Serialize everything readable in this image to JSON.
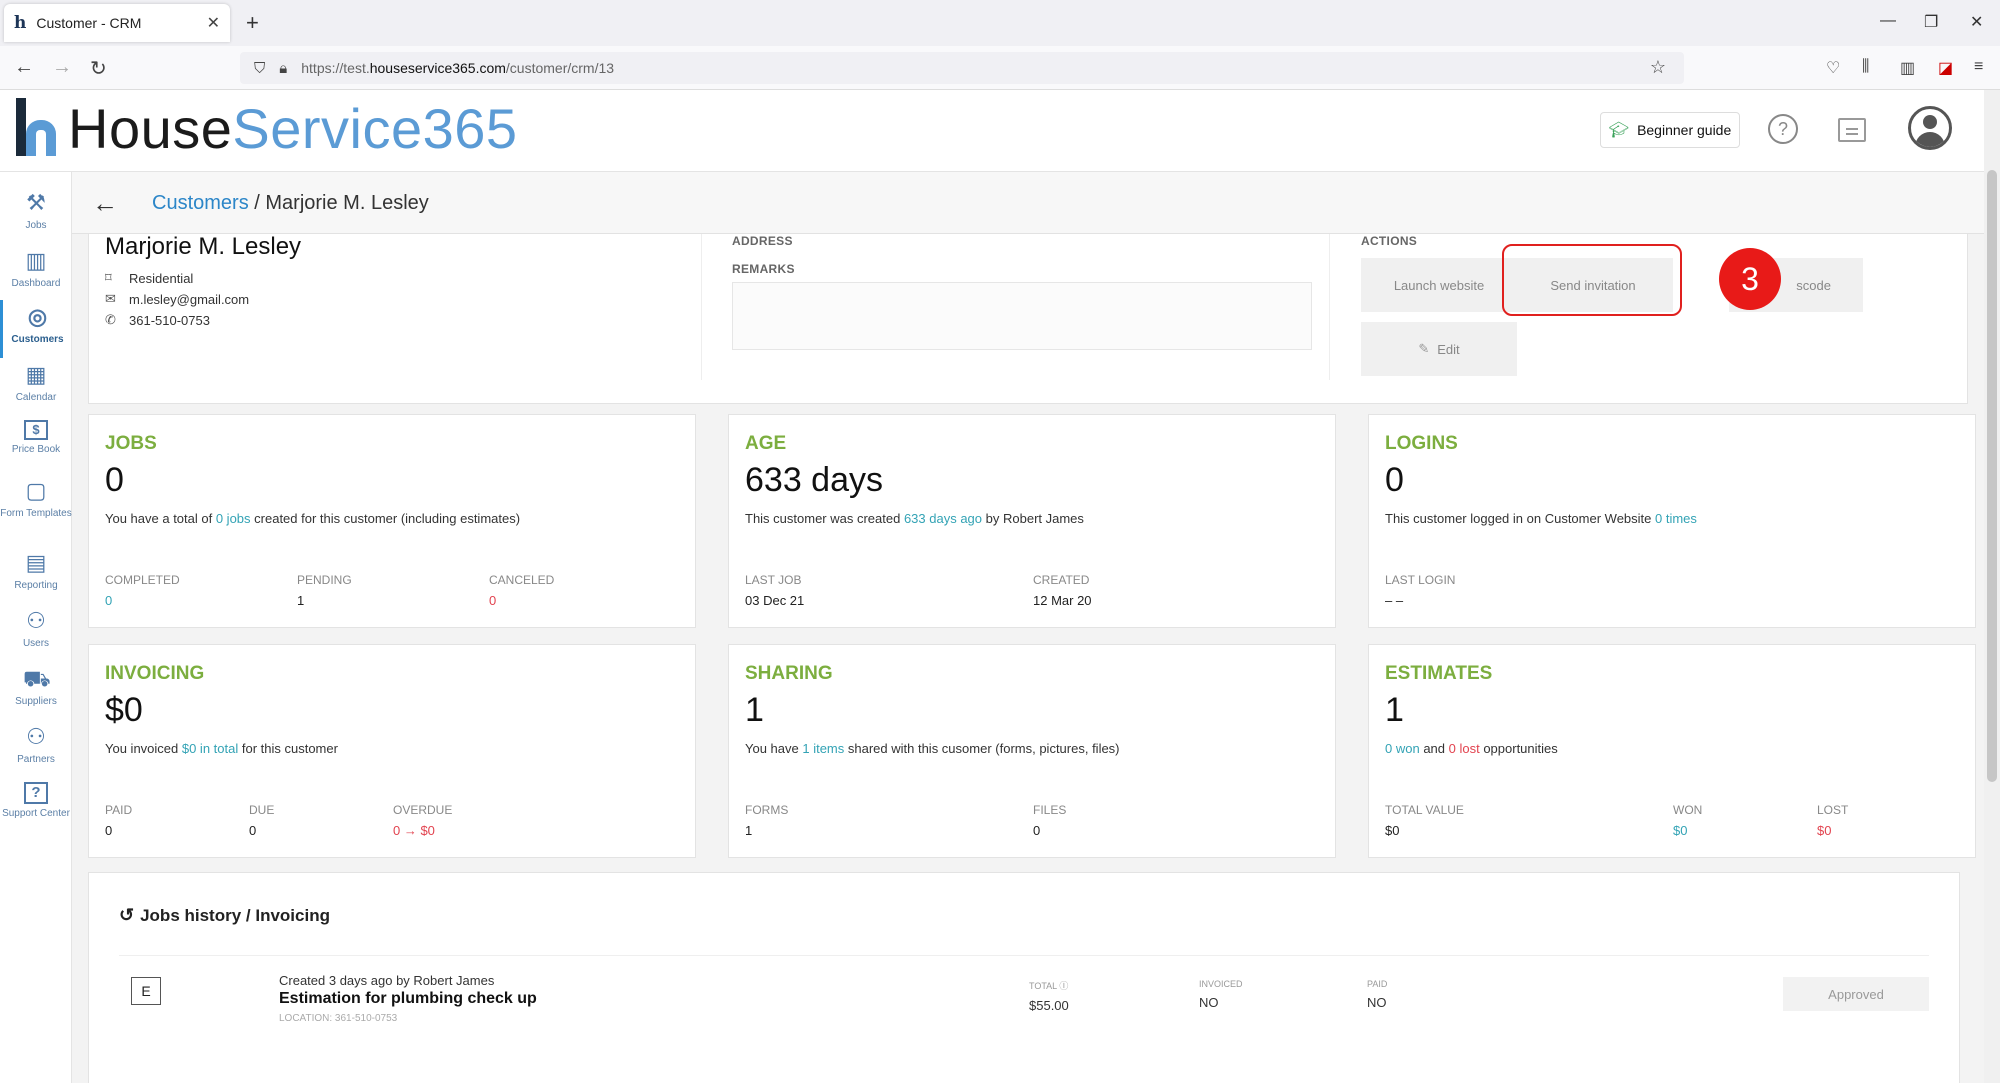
{
  "browser": {
    "tab_title": "Customer - CRM",
    "favicon": "h",
    "new_tab": "+",
    "url_prefix": "https://test.",
    "url_domain": "houseservice365.com",
    "url_path": "/customer/crm/13"
  },
  "header": {
    "logo_house": "House",
    "logo_service": "Service365",
    "guide_label": "Beginner guide",
    "help_glyph": "?"
  },
  "sidebar": {
    "items": [
      {
        "label": "Jobs",
        "icon": "tools-icon",
        "glyph": "⚒"
      },
      {
        "label": "Dashboard",
        "icon": "bar-chart-icon",
        "glyph": "▥"
      },
      {
        "label": "Customers",
        "icon": "target-icon",
        "glyph": "◎"
      },
      {
        "label": "Calendar",
        "icon": "calendar-icon",
        "glyph": "▦"
      },
      {
        "label": "Price Book",
        "icon": "price-tag-icon",
        "glyph": "$"
      },
      {
        "label": "Form Templates",
        "icon": "form-icon",
        "glyph": "▢"
      },
      {
        "label": "Reporting",
        "icon": "report-icon",
        "glyph": "▤"
      },
      {
        "label": "Users",
        "icon": "users-icon",
        "glyph": "⚇"
      },
      {
        "label": "Suppliers",
        "icon": "truck-icon",
        "glyph": "⛟"
      },
      {
        "label": "Partners",
        "icon": "partners-icon",
        "glyph": "⚇"
      },
      {
        "label": "Support Center",
        "icon": "help-box-icon",
        "glyph": "?"
      }
    ]
  },
  "breadcrumb": {
    "root": "Customers",
    "separator": " / ",
    "current": "Marjorie M. Lesley"
  },
  "customer": {
    "name": "Marjorie M. Lesley",
    "type": "Residential",
    "email": "m.lesley@gmail.com",
    "phone": "361-510-0753",
    "address_label": "ADDRESS",
    "remarks_label": "REMARKS",
    "actions_label": "ACTIONS"
  },
  "actions": {
    "launch": "Launch website",
    "send": "Send invitation",
    "passcode": "scode",
    "edit": "Edit"
  },
  "step_badge": "3",
  "stats": {
    "jobs": {
      "title": "JOBS",
      "value": "0",
      "desc_pre": "You have a total of ",
      "desc_link": "0 jobs",
      "desc_post": " created for this customer (including estimates)",
      "completed_label": "COMPLETED",
      "completed": "0",
      "pending_label": "PENDING",
      "pending": "1",
      "canceled_label": "CANCELED",
      "canceled": "0"
    },
    "age": {
      "title": "AGE",
      "value": "633 days",
      "desc_pre": "This customer was created ",
      "desc_link": "633 days ago",
      "desc_post": " by Robert James",
      "last_job_label": "LAST JOB",
      "last_job": "03 Dec 21",
      "created_label": "CREATED",
      "created": "12 Mar 20"
    },
    "logins": {
      "title": "LOGINS",
      "value": "0",
      "desc_pre": "This customer logged in on Customer Website ",
      "desc_link": "0 times",
      "last_login_label": "LAST LOGIN",
      "last_login": "– –"
    },
    "invoicing": {
      "title": "INVOICING",
      "value": "$0",
      "desc_pre": "You invoiced ",
      "desc_link": "$0 in total",
      "desc_post": " for this customer",
      "paid_label": "PAID",
      "paid": "0",
      "due_label": "DUE",
      "due": "0",
      "overdue_label": "OVERDUE",
      "overdue": "0 → $0"
    },
    "sharing": {
      "title": "SHARING",
      "value": "1",
      "desc_pre": "You have ",
      "desc_link": "1 items",
      "desc_post": " shared with this cusomer (forms, pictures, files)",
      "forms_label": "FORMS",
      "forms": "1",
      "files_label": "FILES",
      "files": "0"
    },
    "estimates": {
      "title": "ESTIMATES",
      "value": "1",
      "desc_won": "0 won",
      "desc_and": " and ",
      "desc_lost": "0 lost",
      "desc_post": " opportunities",
      "total_label": "TOTAL VALUE",
      "total": "$0",
      "won_label": "WON",
      "won": "$0",
      "lost_label": "LOST",
      "lost": "$0"
    }
  },
  "history": {
    "title": "Jobs history / Invoicing",
    "entry": {
      "type": "E",
      "created": "Created 3 days ago by Robert James",
      "name": "Estimation for plumbing check up",
      "location": "LOCATION: 361-510-0753",
      "total_label": "TOTAL ⓘ",
      "total": "$55.00",
      "invoiced_label": "INVOICED",
      "invoiced": "NO",
      "paid_label": "PAID",
      "paid": "NO",
      "status": "Approved"
    }
  },
  "colors": {
    "accent_green": "#7cae3f",
    "link_teal": "#33a3b5",
    "alert_red": "#e2434f",
    "highlight_red": "#e0201e"
  }
}
